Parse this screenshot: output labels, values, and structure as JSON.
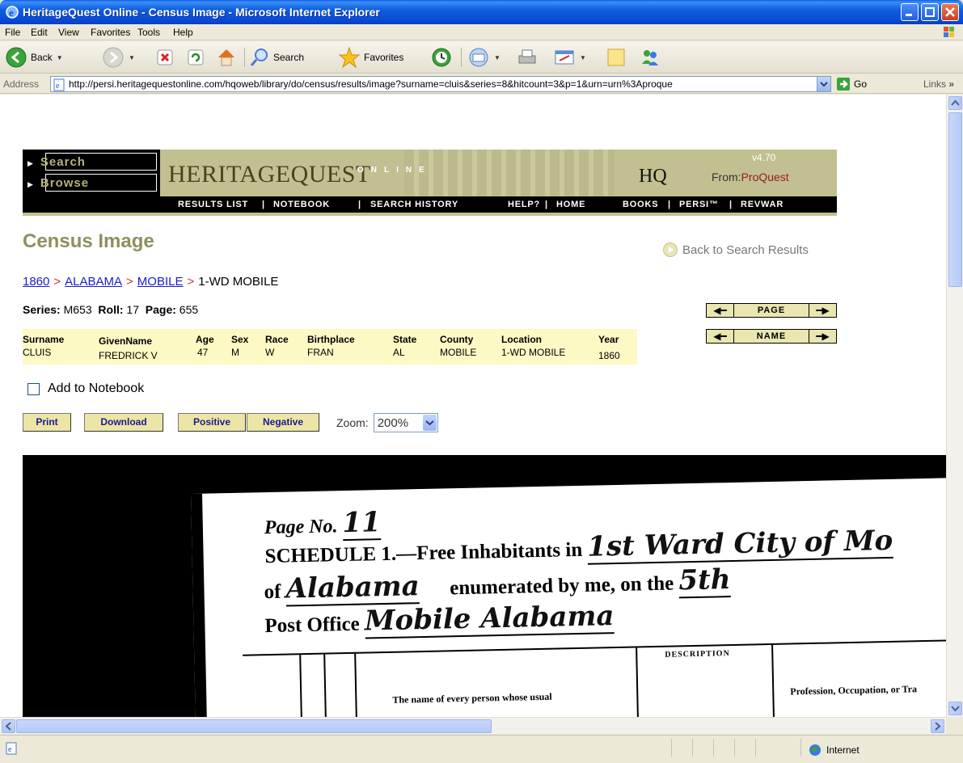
{
  "window": {
    "title": "HeritageQuest Online - Census Image - Microsoft Internet Explorer"
  },
  "menu": [
    "File",
    "Edit",
    "View",
    "Favorites",
    "Tools",
    "Help"
  ],
  "toolbar": {
    "back_label": "Back",
    "search_label": "Search",
    "favorites_label": "Favorites"
  },
  "address": {
    "label": "Address",
    "url": "http://persi.heritagequestonline.com/hqoweb/library/do/census/results/image?surname=cluis&series=8&hitcount=3&p=1&urn=urn%3Aproque",
    "go_label": "Go",
    "links_label": "Links"
  },
  "banner": {
    "search": "Search",
    "browse": "Browse",
    "logo": "HERITAGEQUEST",
    "online": "ONLINE",
    "hq": "HQ",
    "version": "v4.70",
    "from": "From:",
    "proquest": "ProQuest",
    "nav": {
      "results_list": "RESULTS LIST",
      "notebook": "NOTEBOOK",
      "search_history": "SEARCH HISTORY",
      "help": "HELP?",
      "home": "HOME",
      "books": "BOOKS",
      "persi": "PERSI™",
      "revwar": "REVWAR",
      "sep": "|"
    }
  },
  "page": {
    "title": "Census Image",
    "back_to_results": "Back to Search Results",
    "breadcrumb": {
      "year": "1860",
      "state": "ALABAMA",
      "county": "MOBILE",
      "location": "1-WD MOBILE",
      "sep": ">"
    },
    "series_label": "Series:",
    "series_value": "M653",
    "roll_label": "Roll:",
    "roll_value": "17",
    "page_label": "Page:",
    "page_value": "655",
    "pager_page": "PAGE",
    "pager_name": "NAME"
  },
  "record": {
    "headers": {
      "surname": "Surname",
      "givenname": "GivenName",
      "age": "Age",
      "sex": "Sex",
      "race": "Race",
      "birthplace": "Birthplace",
      "state": "State",
      "county": "County",
      "location": "Location",
      "year": "Year"
    },
    "values": {
      "surname": "CLUIS",
      "givenname": "FREDRICK V",
      "age": "47",
      "sex": "M",
      "race": "W",
      "birthplace": "FRAN",
      "state": "AL",
      "county": "MOBILE",
      "location": "1-WD MOBILE",
      "year": "1860"
    }
  },
  "actions": {
    "add_to_notebook": "Add to Notebook",
    "print": "Print",
    "download": "Download",
    "positive": "Positive",
    "negative": "Negative",
    "zoom_label": "Zoom:",
    "zoom_value": "200%"
  },
  "census_image": {
    "page_no": "Page No.",
    "page_no_hw": "11",
    "schedule": "SCHEDULE 1.—Free Inhabitants in",
    "ward_hw": "1st Ward City of Mo",
    "of": "of",
    "state_hw": "Alabama",
    "enumerated": "enumerated by me, on the",
    "day_hw": "5th",
    "post_office": "Post Office",
    "post_office_hw": "Mobile Alabama",
    "description": "DESCRIPTION",
    "name_col": "The name of every person whose usual",
    "profession_col": "Profession, Occupation, or Tra"
  },
  "status": {
    "zone": "Internet"
  }
}
